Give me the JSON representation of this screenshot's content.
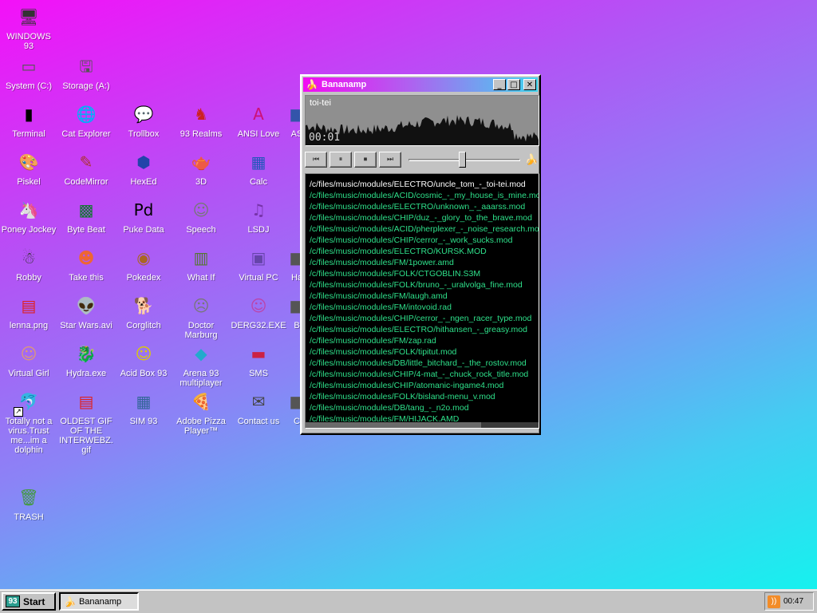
{
  "desktop": {
    "icons": [
      {
        "label": "WINDOWS 93",
        "glyph": "🖥",
        "color": "#333333"
      },
      {
        "label": "System (C:)",
        "glyph": "▭",
        "color": "#555555"
      },
      {
        "label": "Storage (A:)",
        "glyph": "🖫",
        "color": "#555555"
      },
      {
        "label": "Terminal",
        "glyph": "▮",
        "color": "#000000"
      },
      {
        "label": "Cat Explorer",
        "glyph": "🌐",
        "color": "#2277cc"
      },
      {
        "label": "Trollbox",
        "glyph": "💬",
        "color": "#22aaee"
      },
      {
        "label": "93 Realms",
        "glyph": "♞",
        "color": "#cc2222"
      },
      {
        "label": "ANSI Love",
        "glyph": "A",
        "color": "#cc1177"
      },
      {
        "label": "AS",
        "glyph": "■",
        "color": "#3355aa"
      },
      {
        "label": "Piskel",
        "glyph": "🎨",
        "color": "#cc7722"
      },
      {
        "label": "CodeMirror",
        "glyph": "✎",
        "color": "#aa3333"
      },
      {
        "label": "HexEd",
        "glyph": "⬢",
        "color": "#2244aa"
      },
      {
        "label": "3D",
        "glyph": "🫖",
        "color": "#dd8888"
      },
      {
        "label": "Calc",
        "glyph": "▦",
        "color": "#2255bb"
      },
      {
        "label": "Poney Jockey",
        "glyph": "🦄",
        "color": "#9966cc"
      },
      {
        "label": "Byte Beat",
        "glyph": "▩",
        "color": "#117733"
      },
      {
        "label": "Puke Data",
        "glyph": "Pd",
        "color": "#000000"
      },
      {
        "label": "Speech",
        "glyph": "☺",
        "color": "#777777"
      },
      {
        "label": "LSDJ",
        "glyph": "♫",
        "color": "#7733aa"
      },
      {
        "label": "Robby",
        "glyph": "☃",
        "color": "#333333"
      },
      {
        "label": "Take this",
        "glyph": "☻",
        "color": "#ee6633"
      },
      {
        "label": "Pokedex",
        "glyph": "◉",
        "color": "#aa6622"
      },
      {
        "label": "What If",
        "glyph": "▥",
        "color": "#557733"
      },
      {
        "label": "Virtual PC",
        "glyph": "▣",
        "color": "#6644aa"
      },
      {
        "label": "Ha",
        "glyph": "■",
        "color": "#555555"
      },
      {
        "label": "lenna.png",
        "glyph": "▤",
        "color": "#dd2222"
      },
      {
        "label": "Star Wars.avi",
        "glyph": "👽",
        "color": "#558822"
      },
      {
        "label": "Corglitch",
        "glyph": "🐕",
        "color": "#dd8833"
      },
      {
        "label": "Doctor Marburg",
        "glyph": "☹",
        "color": "#777777"
      },
      {
        "label": "DERG32.EXE",
        "glyph": "☺",
        "color": "#bb44aa"
      },
      {
        "label": "B",
        "glyph": "■",
        "color": "#555555"
      },
      {
        "label": "Virtual Girl",
        "glyph": "☺",
        "color": "#dd9977"
      },
      {
        "label": "Hydra.exe",
        "glyph": "🐉",
        "color": "#228833"
      },
      {
        "label": "Acid Box 93",
        "glyph": "☺",
        "color": "#ddcc00"
      },
      {
        "label": "Arena 93 multiplayer",
        "glyph": "◆",
        "color": "#22aacc"
      },
      {
        "label": "SMS",
        "glyph": "▬",
        "color": "#cc2244"
      },
      {
        "label": "Totally not a virus.Trust me...im a dolphin",
        "glyph": "🐬",
        "color": "#2288cc"
      },
      {
        "label": "OLDEST GIF OF THE INTERWEBZ.gif",
        "glyph": "▤",
        "color": "#dd2222"
      },
      {
        "label": "SIM 93",
        "glyph": "▦",
        "color": "#336699"
      },
      {
        "label": "Adobe Pizza Player™",
        "glyph": "🍕",
        "color": "#dd8833"
      },
      {
        "label": "Contact us",
        "glyph": "✉",
        "color": "#444444"
      },
      {
        "label": "C",
        "glyph": "■",
        "color": "#555555"
      },
      {
        "label": "TRASH",
        "glyph": "🗑",
        "color": "#449944"
      }
    ]
  },
  "window": {
    "title": "Bananamp",
    "minimize": "_",
    "maximize": "□",
    "close": "✕",
    "now_playing": "toi-tei",
    "time": "00:01",
    "seek_position": 0.48,
    "controls": {
      "prev": "⏮",
      "pause": "⏸",
      "stop": "⏹",
      "next": "⏭"
    },
    "playlist": [
      "/c/files/music/modules/ELECTRO/uncle_tom_-_toi-tei.mod",
      "/c/files/music/modules/ACID/cosmic_-_my_house_is_mine.mod",
      "/c/files/music/modules/ELECTRO/unknown_-_aaarss.mod",
      "/c/files/music/modules/CHIP/duz_-_glory_to_the_brave.mod",
      "/c/files/music/modules/ACID/pherplexer_-_noise_research.mod",
      "/c/files/music/modules/CHIP/cerror_-_work_sucks.mod",
      "/c/files/music/modules/ELECTRO/KURSK.MOD",
      "/c/files/music/modules/FM/1power.amd",
      "/c/files/music/modules/FOLK/CTGOBLIN.S3M",
      "/c/files/music/modules/FOLK/bruno_-_uralvolga_fine.mod",
      "/c/files/music/modules/FM/laugh.amd",
      "/c/files/music/modules/FM/intovoid.rad",
      "/c/files/music/modules/CHIP/cerror_-_ngen_racer_type.mod",
      "/c/files/music/modules/ELECTRO/hithansen_-_greasy.mod",
      "/c/files/music/modules/FM/zap.rad",
      "/c/files/music/modules/FOLK/tipitut.mod",
      "/c/files/music/modules/DB/little_bitchard_-_the_rostov.mod",
      "/c/files/music/modules/CHIP/4-mat_-_chuck_rock_title.mod",
      "/c/files/music/modules/CHIP/atomanic-ingame4.mod",
      "/c/files/music/modules/FOLK/bisland-menu_v.mod",
      "/c/files/music/modules/DB/tang_-_n2o.mod",
      "/c/files/music/modules/FM/HIJACK.AMD"
    ]
  },
  "taskbar": {
    "start_label": "Start",
    "start_glyph": "93",
    "task_label": "Bananamp",
    "clock": "00:47",
    "tray_icon": "rss-icon"
  },
  "colors": {
    "playlist_text": "#2ee08a",
    "playlist_active": "#ffffff",
    "title_gradient_start": "#f20cf2",
    "title_gradient_end": "#40d6f0"
  }
}
